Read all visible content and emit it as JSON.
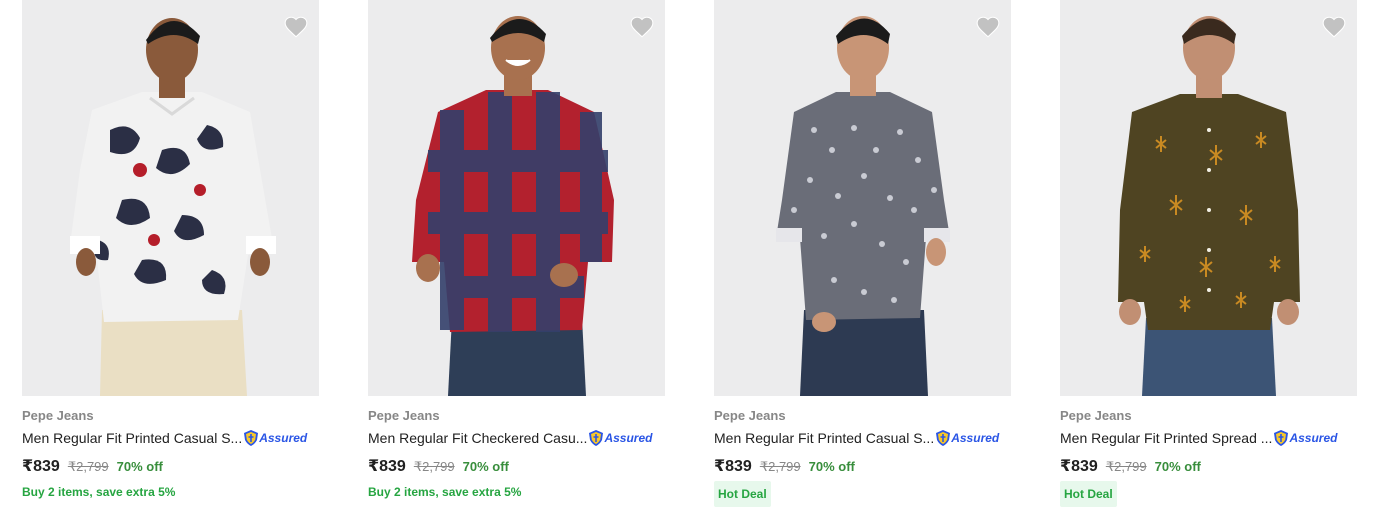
{
  "products": [
    {
      "brand": "Pepe Jeans",
      "title": "Men Regular Fit Printed Casual S...",
      "assured": "Assured",
      "price": "₹839",
      "mrp": "₹2,799",
      "discount": "70% off",
      "offer": "Buy 2 items, save extra 5%",
      "image_alt": "man in white and navy camo print shirt with beige trousers",
      "shirt_color": "#f2f2f2",
      "shirt_pattern_color": "#2b2f45"
    },
    {
      "brand": "Pepe Jeans",
      "title": "Men Regular Fit Checkered Casu...",
      "assured": "Assured",
      "price": "₹839",
      "mrp": "₹2,799",
      "discount": "70% off",
      "offer": "Buy 2 items, save extra 5%",
      "image_alt": "smiling man in red and navy checkered shirt with dark jeans",
      "shirt_color": "#b3212e",
      "shirt_pattern_color": "#34406b"
    },
    {
      "brand": "Pepe Jeans",
      "title": "Men Regular Fit Printed Casual S...",
      "assured": "Assured",
      "price": "₹839",
      "mrp": "₹2,799",
      "discount": "70% off",
      "tag": "Hot Deal",
      "image_alt": "man in grey paisley print shirt with dark jeans",
      "shirt_color": "#6a6d78",
      "shirt_pattern_color": "#c9cbd3"
    },
    {
      "brand": "Pepe Jeans",
      "title": "Men Regular Fit Printed Spread ...",
      "assured": "Assured",
      "price": "₹839",
      "mrp": "₹2,799",
      "discount": "70% off",
      "tag": "Hot Deal",
      "image_alt": "man in olive brown shirt with orange floral print and blue jeans",
      "shirt_color": "#4f4422",
      "shirt_pattern_color": "#c98a22"
    }
  ],
  "icons": {
    "wishlist": "heart-icon",
    "assured": "assured-badge-icon"
  }
}
